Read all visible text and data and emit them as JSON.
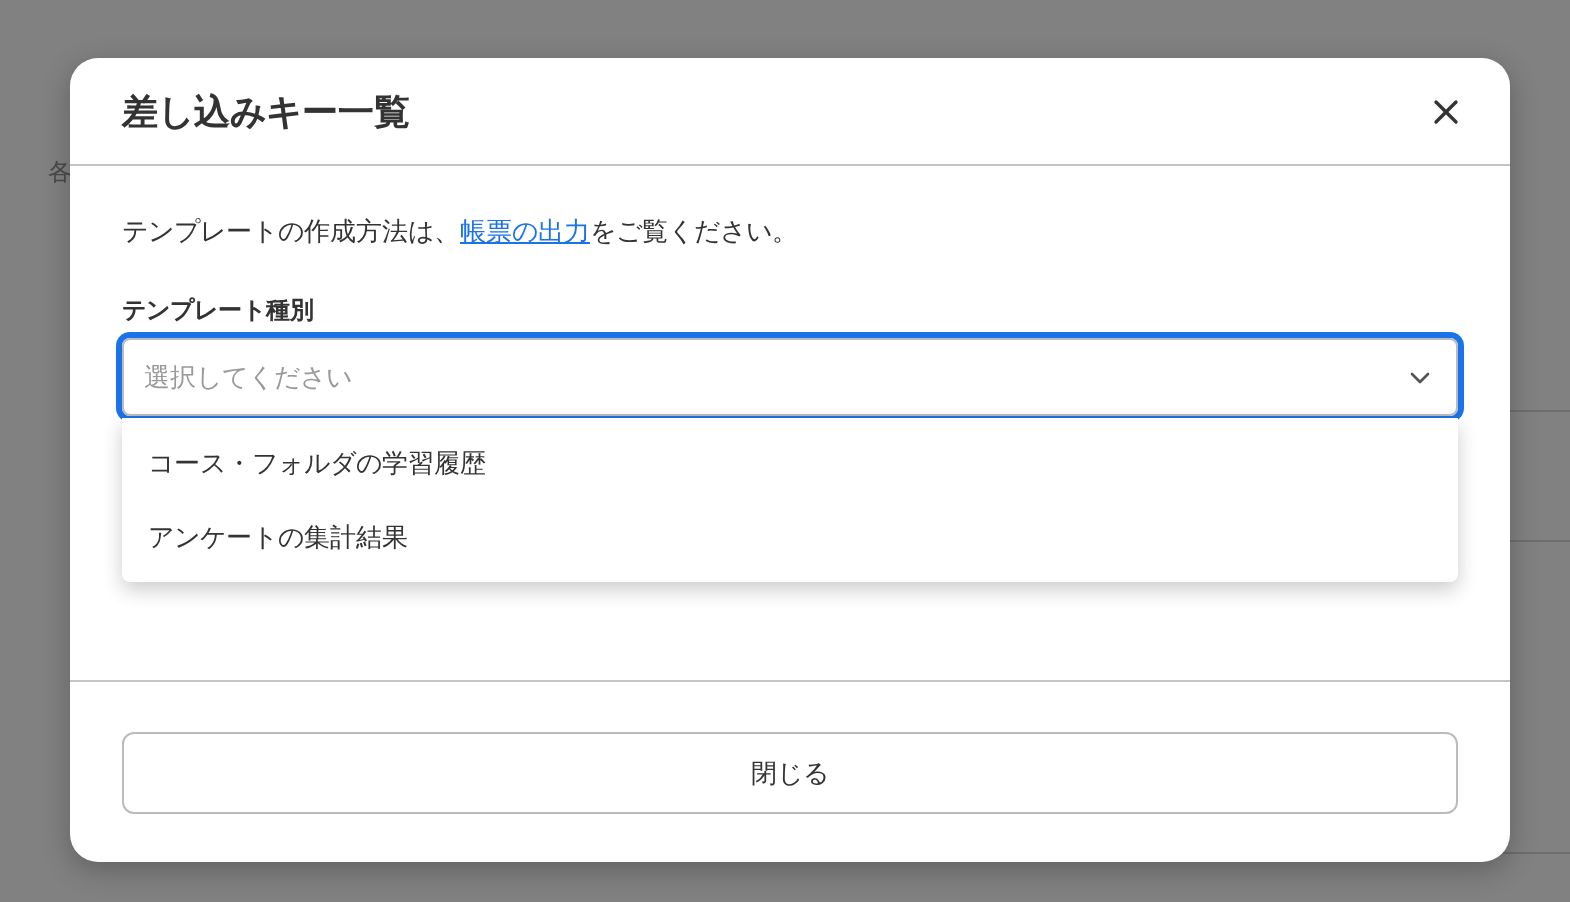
{
  "background_page": {
    "subtitle": "各"
  },
  "dialog": {
    "title": "差し込みキー一覧",
    "intro": {
      "before": "テンプレートの作成方法は、",
      "link": "帳票の出力",
      "after": "をご覧ください。"
    },
    "template_type": {
      "label": "テンプレート種別",
      "placeholder": "選択してください",
      "focused": true,
      "expanded": true,
      "options": [
        {
          "label": "コース・フォルダの学習履歴",
          "selected": false
        },
        {
          "label": "アンケートの集計結果",
          "selected": false
        }
      ]
    },
    "close_button": "閉じる"
  }
}
